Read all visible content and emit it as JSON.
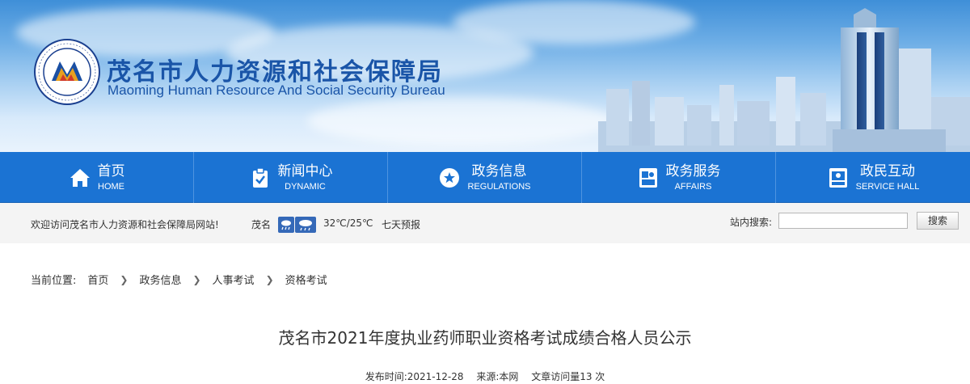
{
  "header": {
    "title_cn": "茂名市人力资源和社会保障局",
    "title_en": "Maoming Human Resource And Social Security Bureau"
  },
  "nav": [
    {
      "label": "首页",
      "sub": "HOME",
      "icon": "home-icon"
    },
    {
      "label": "新闻中心",
      "sub": "DYNAMIC",
      "icon": "clipboard-check-icon"
    },
    {
      "label": "政务信息",
      "sub": "REGULATIONS",
      "icon": "star-icon"
    },
    {
      "label": "政务服务",
      "sub": "AFFAIRS",
      "icon": "service-window-icon"
    },
    {
      "label": "政民互动",
      "sub": "SERVICE HALL",
      "icon": "interaction-window-icon"
    }
  ],
  "infobar": {
    "welcome": "欢迎访问茂名市人力资源和社会保障局网站!",
    "city": "茂名",
    "temperature": "32℃/25℃",
    "forecast": "七天预报",
    "search_label": "站内搜索:",
    "search_value": "",
    "search_button": "搜索"
  },
  "breadcrumb": {
    "label": "当前位置:",
    "items": [
      "首页",
      "政务信息",
      "人事考试",
      "资格考试"
    ]
  },
  "article": {
    "title": "茂名市2021年度执业药师职业资格考试成绩合格人员公示",
    "publish_time": "发布时间:2021-12-28",
    "source": "来源:本网",
    "visits": "文章访问量13 次"
  },
  "colors": {
    "nav_bg": "#1b73d3",
    "title_blue": "#1a55a8"
  }
}
